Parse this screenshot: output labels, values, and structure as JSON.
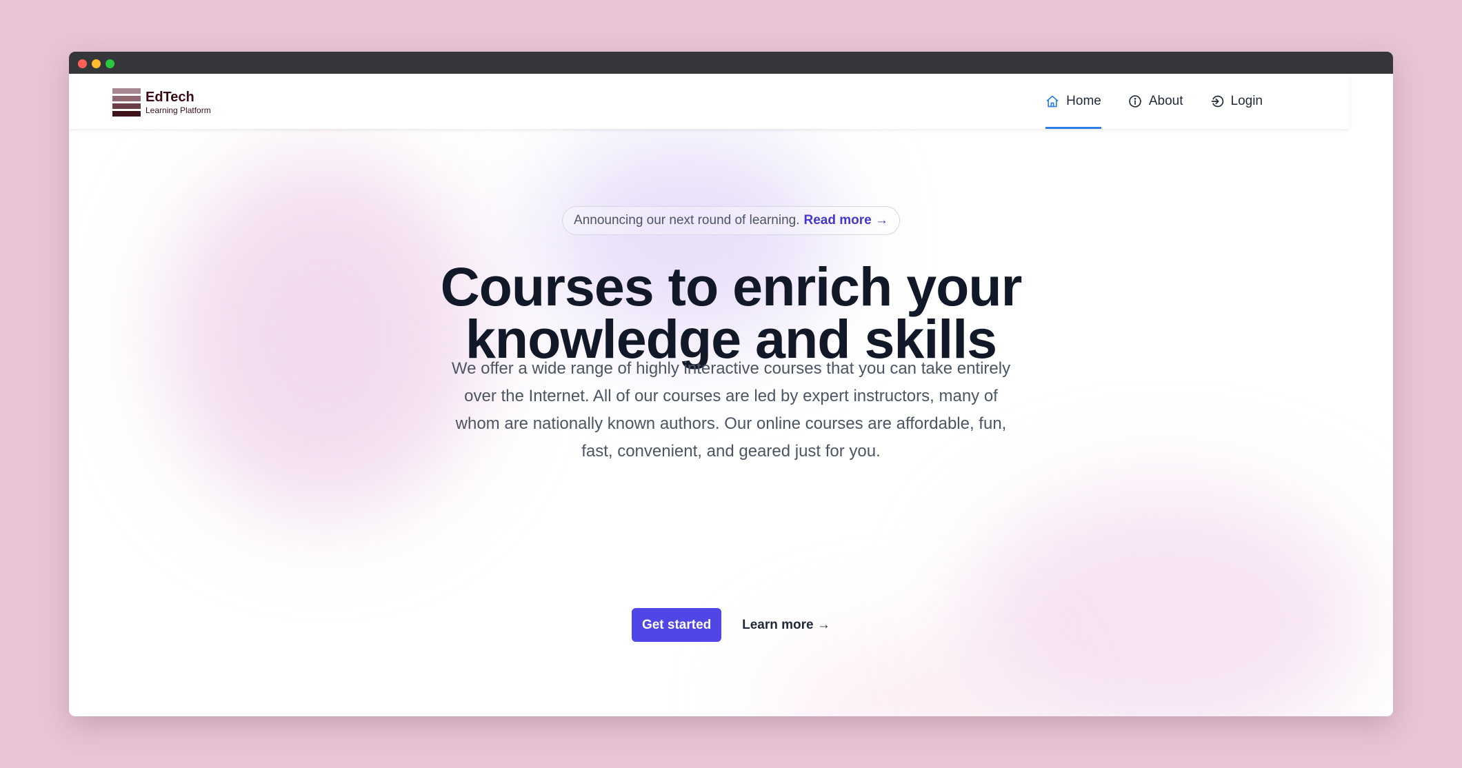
{
  "window_controls": [
    "close",
    "minimize",
    "maximize"
  ],
  "brand": {
    "name": "EdTech",
    "tagline": "Learning Platform"
  },
  "nav": {
    "items": [
      {
        "label": "Home",
        "icon": "home-icon",
        "active": true
      },
      {
        "label": "About",
        "icon": "info-icon",
        "active": false
      },
      {
        "label": "Login",
        "icon": "login-icon",
        "active": false
      }
    ]
  },
  "hero": {
    "announcement": {
      "text": "Announcing our next round of learning.",
      "link_label": "Read more →"
    },
    "title": "Courses to enrich your knowledge and skills",
    "description": "We offer a wide range of highly interactive courses that you can take entirely over the Internet. All of our courses are led by expert instructors, many of whom are nationally known authors. Our online courses are affordable, fun, fast, convenient, and geared just for you.",
    "primary_button": "Get started",
    "secondary_button": "Learn more →"
  },
  "colors": {
    "page_background": "#e8c5d6",
    "accent": "#4f46e5",
    "link": "#4338ca",
    "nav_active_underline": "#2f7ee6",
    "brand_text": "#3a0d14",
    "heading": "#111827"
  }
}
